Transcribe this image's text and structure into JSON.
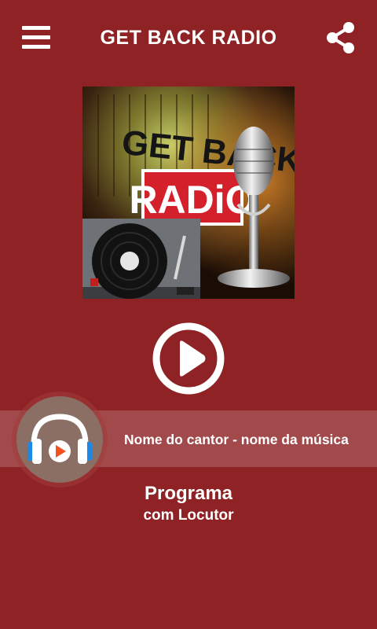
{
  "header": {
    "title": "GET BACK RADIO",
    "menu_icon": "hamburger-menu-icon",
    "share_icon": "share-icon"
  },
  "cover": {
    "line1": "GET BACK",
    "line2": "RADiO"
  },
  "player": {
    "play_icon": "play-icon",
    "avatar_icon": "headphones-play-icon",
    "now_playing": "Nome do cantor - nome da música",
    "program": "Programa",
    "host": "com Locutor"
  },
  "colors": {
    "background": "#8e2224",
    "strip": "#ffffff2e",
    "avatar_bg": "#8c6f64",
    "logo_red": "#d3202b"
  }
}
